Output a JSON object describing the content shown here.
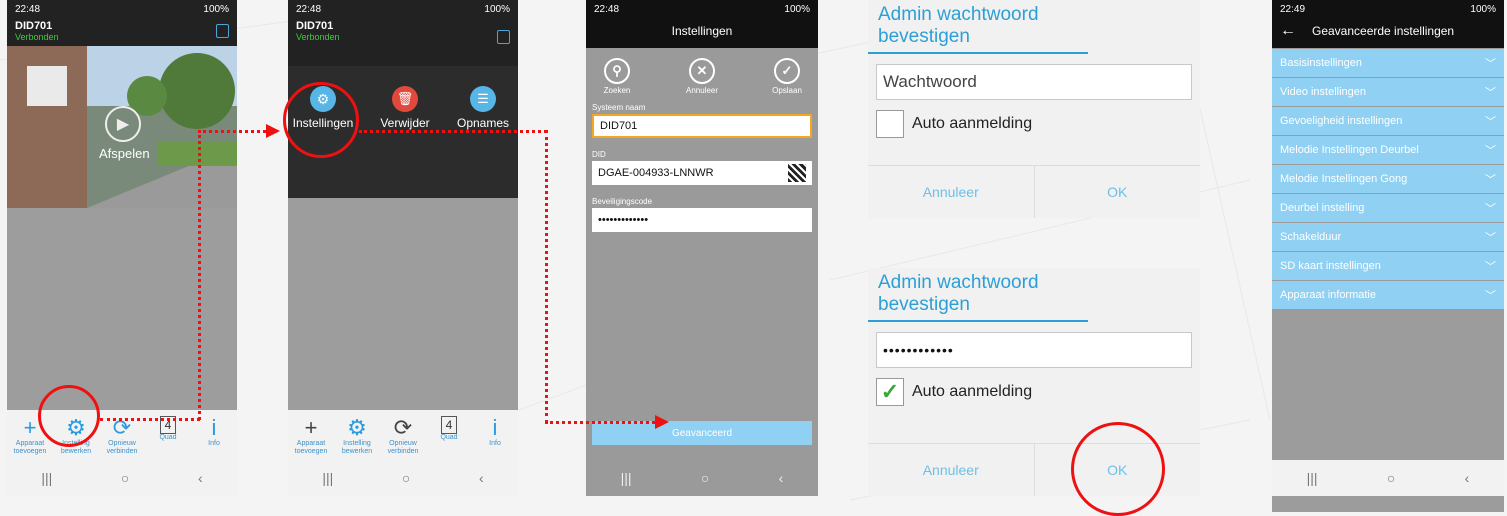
{
  "colors": {
    "accent": "#2d9fd6",
    "connected": "#3fcb3f",
    "highlight": "#e11111",
    "menu": "#8fd0f3"
  },
  "screen1": {
    "time": "22:48",
    "signal": "100%",
    "device_name": "DID701",
    "device_status": "Verbonden",
    "play_label": "Afspelen",
    "toolbar": [
      {
        "icon": "plus-icon",
        "label": "Apparaat toevoegen"
      },
      {
        "icon": "gear-icon",
        "label": "Instelling bewerken"
      },
      {
        "icon": "refresh-icon",
        "label": "Opnieuw verbinden"
      },
      {
        "icon": "quad-icon",
        "label": "Quad"
      },
      {
        "icon": "info-icon",
        "label": "Info"
      }
    ]
  },
  "screen2": {
    "time": "22:48",
    "signal": "100%",
    "device_name": "DID701",
    "device_status": "Verbonden",
    "overlay": [
      {
        "icon": "gear-icon",
        "label": "Instellingen"
      },
      {
        "icon": "trash-icon",
        "label": "Verwijder"
      },
      {
        "icon": "recordings-icon",
        "label": "Opnames"
      }
    ],
    "toolbar": [
      {
        "icon": "plus-icon",
        "label": "Apparaat toevoegen"
      },
      {
        "icon": "gear-icon",
        "label": "Instelling bewerken"
      },
      {
        "icon": "refresh-icon",
        "label": "Opnieuw verbinden"
      },
      {
        "icon": "quad-icon",
        "label": "Quad"
      },
      {
        "icon": "info-icon",
        "label": "Info"
      }
    ]
  },
  "screen3": {
    "time": "22:48",
    "signal": "100%",
    "title": "Instellingen",
    "actions": [
      {
        "icon": "search-icon",
        "label": "Zoeken"
      },
      {
        "icon": "close-icon",
        "label": "Annuleer"
      },
      {
        "icon": "check-icon",
        "label": "Opslaan"
      }
    ],
    "system_name_label": "Systeem naam",
    "system_name_value": "DID701",
    "did_label": "DID",
    "did_value": "DGAE-004933-LNNWR",
    "security_label": "Beveiligingscode",
    "security_value": "•••••••••••••",
    "advanced_button": "Geavanceerd"
  },
  "dialog1": {
    "title": "Admin wachtwoord bevestigen",
    "password_placeholder": "Wachtwoord",
    "auto_login": "Auto aanmelding",
    "checked": false,
    "cancel": "Annuleer",
    "ok": "OK"
  },
  "dialog2": {
    "title": "Admin wachtwoord bevestigen",
    "password_value": "••••••••••••",
    "auto_login": "Auto aanmelding",
    "checked": true,
    "cancel": "Annuleer",
    "ok": "OK"
  },
  "screen5": {
    "time": "22:49",
    "signal": "100%",
    "title": "Geavanceerde instellingen",
    "items": [
      "Basisinstellingen",
      "Video instellingen",
      "Gevoeligheid instellingen",
      "Melodie Instellingen Deurbel",
      "Melodie Instellingen Gong",
      "Deurbel instelling",
      "Schakelduur",
      "SD kaart instellingen",
      "Apparaat informatie"
    ]
  }
}
